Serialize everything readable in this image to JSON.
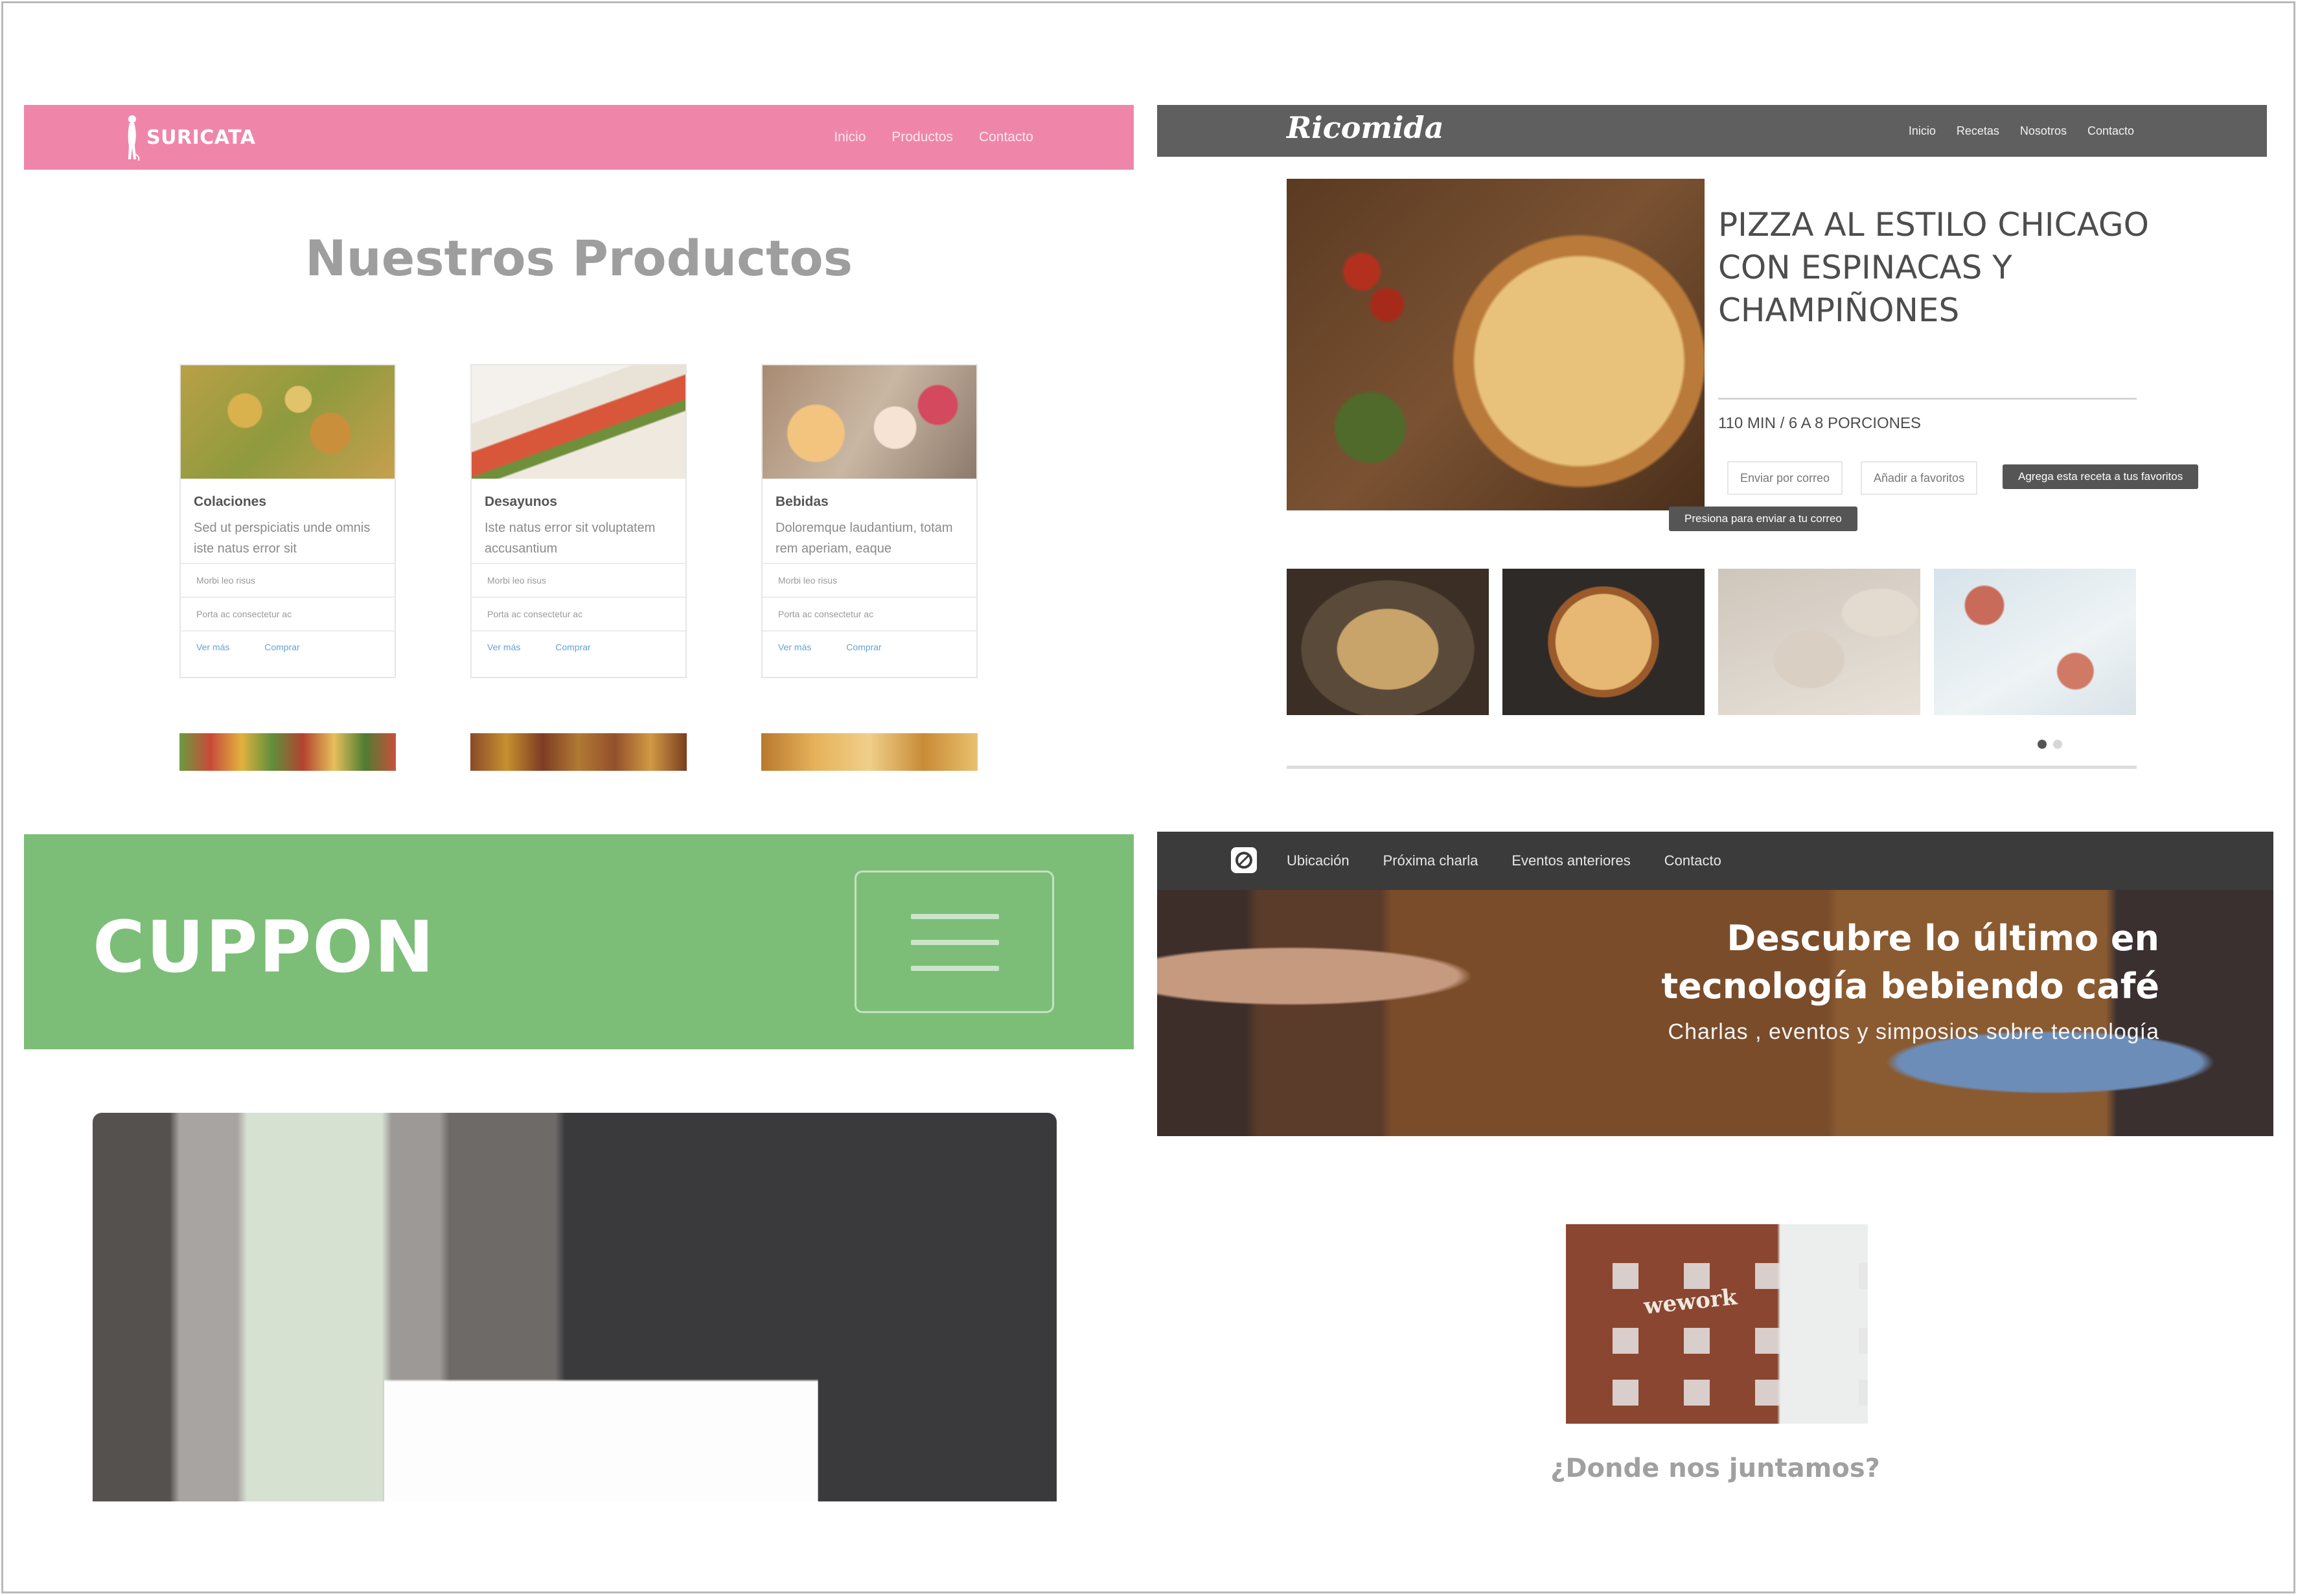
{
  "suricata": {
    "brand": "SURICATA",
    "nav": [
      "Inicio",
      "Productos",
      "Contacto"
    ],
    "heading": "Nuestros Productos",
    "products": [
      {
        "name": "Colaciones",
        "desc": "Sed ut perspiciatis unde omnis iste natus error sit",
        "item1": "Morbi leo risus",
        "item2": "Porta ac consectetur ac",
        "link1": "Ver más",
        "link2": "Comprar"
      },
      {
        "name": "Desayunos",
        "desc": "Iste natus error sit voluptatem accusantium",
        "item1": "Morbi leo risus",
        "item2": "Porta ac consectetur ac",
        "link1": "Ver más",
        "link2": "Comprar"
      },
      {
        "name": "Bebidas",
        "desc": "Doloremque laudantium, totam rem aperiam, eaque",
        "item1": "Morbi leo risus",
        "item2": "Porta ac consectetur ac",
        "link1": "Ver más",
        "link2": "Comprar"
      }
    ],
    "accent": "#ef86a9"
  },
  "ricomida": {
    "brand": "Ricomida",
    "nav": [
      "Inicio",
      "Recetas",
      "Nosotros",
      "Contacto"
    ],
    "recipe_title": "PIZZA AL ESTILO CHICAGO CON ESPINACAS Y CHAMPIÑONES",
    "meta": "110 MIN / 6 A 8 PORCIONES",
    "btn_email": "Enviar por correo",
    "btn_fav": "Añadir a favoritos",
    "tip_fav": "Agrega esta receta a tus favoritos",
    "tip_email": "Presiona para enviar a tu correo",
    "carousel_page": 1,
    "carousel_pages": 2
  },
  "cuppon": {
    "brand": "CUPPON",
    "accent": "#7cbe78"
  },
  "techcafe": {
    "nav": [
      "Ubicación",
      "Próxima charla",
      "Eventos anteriores",
      "Contacto"
    ],
    "hero_title": "Descubre lo último en tecnología bebiendo café",
    "hero_subtitle": "Charlas , eventos y simposios sobre tecnología",
    "building_sign": "wework",
    "question": "¿Donde nos juntamos?"
  }
}
